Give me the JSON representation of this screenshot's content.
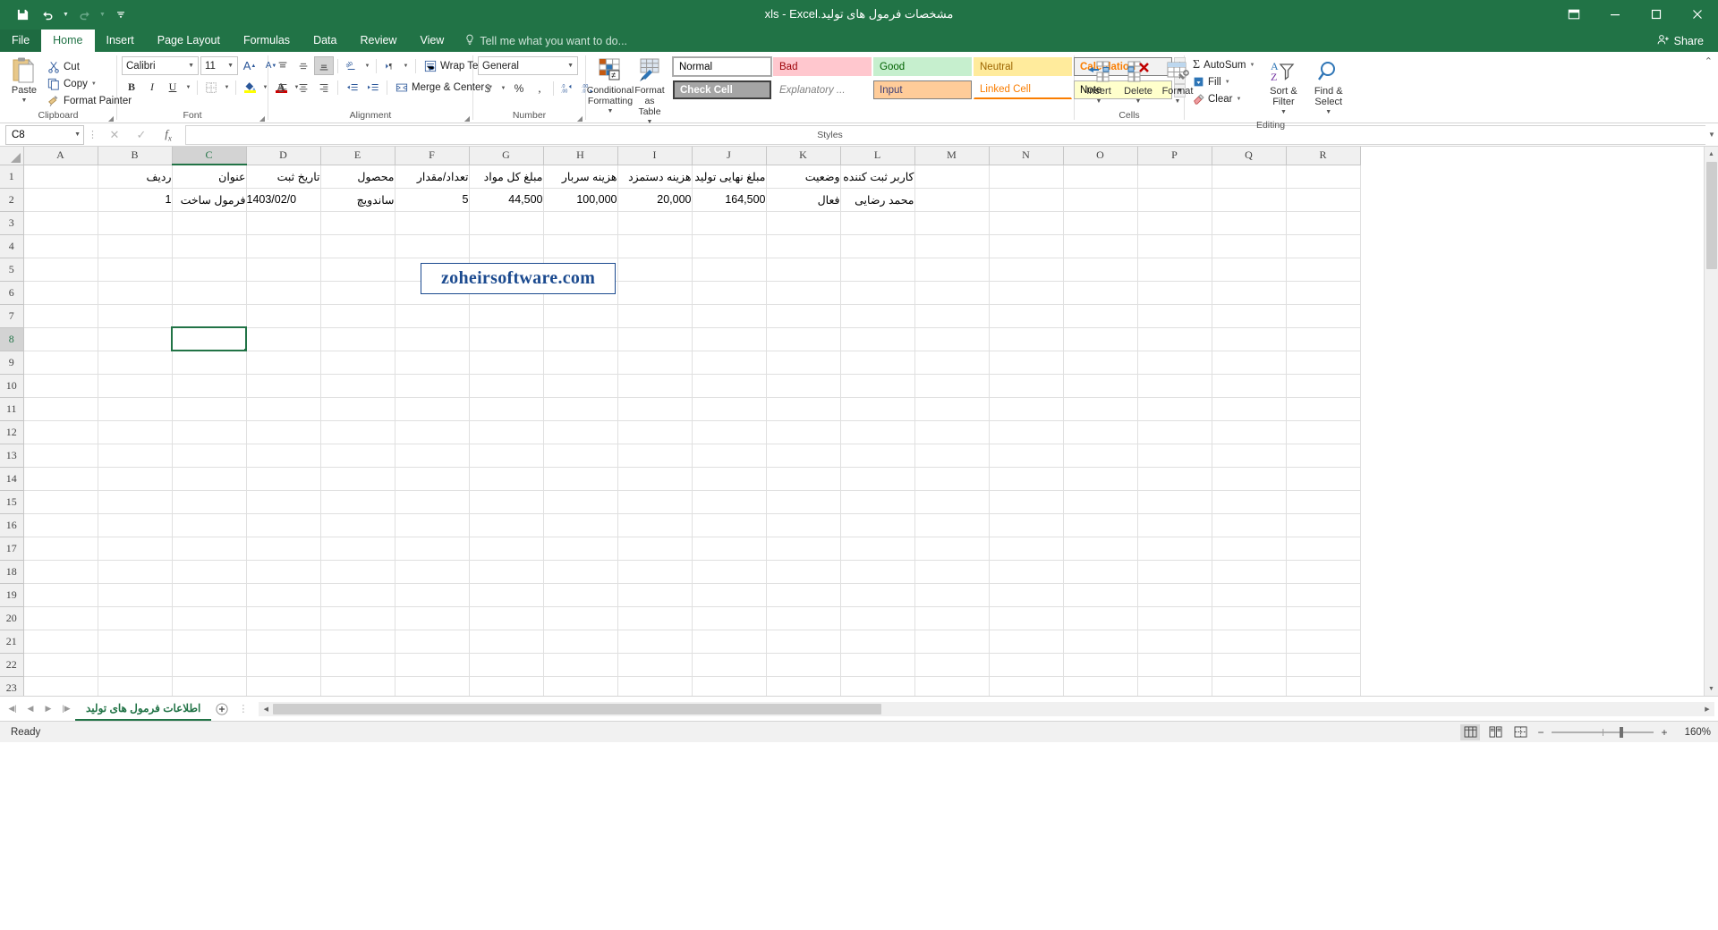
{
  "window": {
    "title": "مشخصات فرمول های تولید.xls - Excel",
    "quick_access": {
      "save": "save-icon",
      "undo": "undo-icon",
      "redo": "redo-icon",
      "customize": "customize-icon"
    },
    "buttons": {
      "ribbon_display": "⊟",
      "minimize": "—",
      "maximize": "▢",
      "close": "✕"
    }
  },
  "tabs": [
    {
      "label": "File",
      "active": false,
      "file": true
    },
    {
      "label": "Home",
      "active": true
    },
    {
      "label": "Insert",
      "active": false
    },
    {
      "label": "Page Layout",
      "active": false
    },
    {
      "label": "Formulas",
      "active": false
    },
    {
      "label": "Data",
      "active": false
    },
    {
      "label": "Review",
      "active": false
    },
    {
      "label": "View",
      "active": false
    }
  ],
  "tellme": {
    "placeholder": "Tell me what you want to do...",
    "icon": "lightbulb-icon"
  },
  "share": {
    "label": "Share",
    "icon": "share-person-icon"
  },
  "ribbon": {
    "clipboard": {
      "group_label": "Clipboard",
      "paste": "Paste",
      "cut": "Cut",
      "copy": "Copy",
      "format_painter": "Format Painter"
    },
    "font": {
      "group_label": "Font",
      "font_name": "Calibri",
      "font_size": "11",
      "grow": "A",
      "shrink": "A",
      "bold": "B",
      "italic": "I",
      "underline": "U",
      "borders": "borders-icon",
      "fill_color": "fill-color-icon",
      "font_color": "font-color-icon"
    },
    "alignment": {
      "group_label": "Alignment",
      "wrap_text": "Wrap Text",
      "merge_center": "Merge & Center",
      "align_top": "align-top-icon",
      "align_middle": "align-middle-icon",
      "align_bottom": "align-bottom-icon",
      "orientation": "orientation-icon",
      "rtl_text": "text-direction-icon",
      "align_left": "align-left-icon",
      "align_center": "align-center-icon",
      "align_right": "align-right-icon",
      "decrease_indent": "decrease-indent-icon",
      "increase_indent": "increase-indent-icon"
    },
    "number": {
      "group_label": "Number",
      "format": "General",
      "currency": "$",
      "percent": "%",
      "comma": ",",
      "increase_decimal": ".00",
      "decrease_decimal": ".0"
    },
    "styles": {
      "group_label": "Styles",
      "conditional_formatting": "Conditional Formatting",
      "format_as_table": "Format as Table",
      "cells": [
        {
          "label": "Normal",
          "bg": "#ffffff",
          "fg": "#000000",
          "border": "#a6a6a6"
        },
        {
          "label": "Bad",
          "bg": "#ffc7ce",
          "fg": "#9c0006",
          "border": "#ffc7ce"
        },
        {
          "label": "Good",
          "bg": "#c6efce",
          "fg": "#006100",
          "border": "#c6efce"
        },
        {
          "label": "Neutral",
          "bg": "#ffeb9c",
          "fg": "#9c6500",
          "border": "#ffeb9c"
        },
        {
          "label": "Calculation",
          "bg": "#f2f2f2",
          "fg": "#fa7d00",
          "border": "#7f7f7f"
        },
        {
          "label": "Check Cell",
          "bg": "#a5a5a5",
          "fg": "#ffffff",
          "border": "#3f3f3f"
        },
        {
          "label": "Explanatory ...",
          "bg": "#ffffff",
          "fg": "#7f7f7f",
          "border": "#ffffff"
        },
        {
          "label": "Input",
          "bg": "#ffcc99",
          "fg": "#3f3f76",
          "border": "#7f7f7f"
        },
        {
          "label": "Linked Cell",
          "bg": "#ffffff",
          "fg": "#fa7d00",
          "border": "#ffffff"
        },
        {
          "label": "Note",
          "bg": "#ffffcc",
          "fg": "#000000",
          "border": "#b2b2b2"
        }
      ]
    },
    "cells": {
      "group_label": "Cells",
      "insert": "Insert",
      "delete": "Delete",
      "format": "Format"
    },
    "editing": {
      "group_label": "Editing",
      "autosum": "AutoSum",
      "fill": "Fill",
      "clear": "Clear",
      "sort_filter": "Sort & Filter",
      "find_select": "Find & Select"
    }
  },
  "formula_bar": {
    "name_box": "C8",
    "cancel": "cancel-icon",
    "enter": "enter-icon",
    "insert_function": "fx",
    "value": ""
  },
  "watermark": {
    "text": "zoheirsoftware.com"
  },
  "grid": {
    "columns": [
      "A",
      "B",
      "C",
      "D",
      "E",
      "F",
      "G",
      "H",
      "I",
      "J",
      "K",
      "L",
      "M",
      "N",
      "O",
      "P",
      "Q",
      "R"
    ],
    "selected_column": "C",
    "rows": [
      "1",
      "2",
      "3",
      "4",
      "5",
      "6",
      "7",
      "8",
      "9",
      "10",
      "11",
      "12",
      "13",
      "14",
      "15",
      "16",
      "17",
      "18",
      "19",
      "20",
      "21",
      "22",
      "23"
    ],
    "selected_row": "8",
    "selected_cell": "C8",
    "headers": {
      "B": "ردیف",
      "C": "عنوان",
      "D": "تاریخ ثبت",
      "E": "محصول",
      "F": "تعداد/مقدار",
      "G": "مبلغ کل مواد",
      "H": "هزینه سربار",
      "I": "هزینه دستمزد",
      "J": "مبلغ نهایی تولید",
      "K": "وضعیت",
      "L": "کاربر ثبت کننده"
    },
    "data_row": {
      "B": "1",
      "C": "فرمول ساخت",
      "D": "1403/02/0",
      "E": "ساندویچ",
      "F": "5",
      "G": "44,500",
      "H": "100,000",
      "I": "20,000",
      "J": "164,500",
      "K": "فعال",
      "L": "محمد رضایی"
    }
  },
  "sheet_tabs": {
    "first": "first-sheet-icon",
    "prev": "prev-sheet-icon",
    "next": "next-sheet-icon",
    "last": "last-sheet-icon",
    "tabs": [
      {
        "label": "اطلاعات فرمول های تولید",
        "active": true
      }
    ],
    "add": "+"
  },
  "status_bar": {
    "mode": "Ready",
    "views": {
      "normal": "normal-view-icon",
      "page_layout": "page-layout-view-icon",
      "page_break": "page-break-view-icon"
    },
    "zoom_out": "−",
    "zoom_in": "+",
    "zoom_level": "160%"
  },
  "theme": {
    "accent": "#217346",
    "ribbon_bg": "#ffffff",
    "grid_line": "#e0e0e0",
    "header_bg": "#f0f0f0"
  }
}
